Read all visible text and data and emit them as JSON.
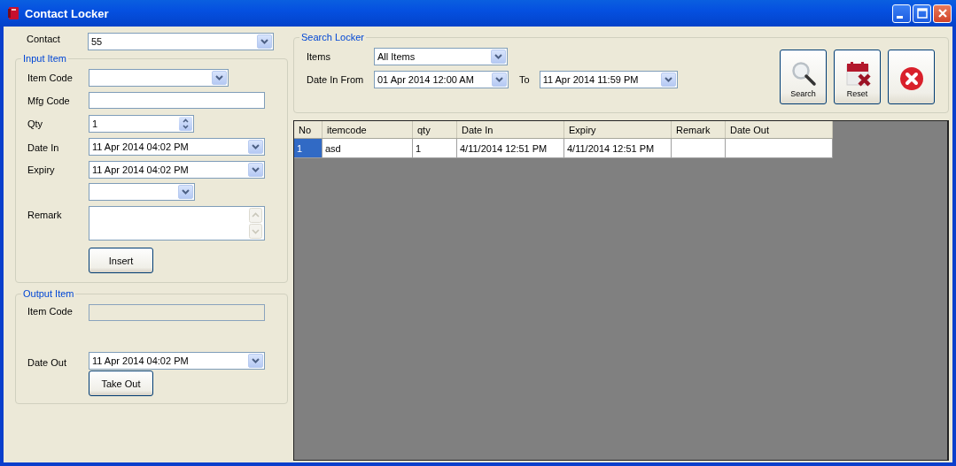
{
  "window": {
    "title": "Contact Locker"
  },
  "contact": {
    "label": "Contact",
    "value": "55"
  },
  "input_item": {
    "title": "Input Item",
    "fields": [
      {
        "kind": "combo",
        "label": "Item Code"
      },
      {
        "kind": "text",
        "label": "Mfg Code"
      },
      {
        "kind": "spinner",
        "label": "Qty",
        "value": "1"
      },
      {
        "kind": "date",
        "label": "Date In",
        "value": "11  Apr  2014 04:02 PM"
      },
      {
        "kind": "date",
        "label": "Expiry",
        "value": "11  Apr  2014  04:02 PM"
      },
      {
        "kind": "combo"
      },
      {
        "kind": "memo",
        "label": "Remark"
      }
    ],
    "button": "Insert"
  },
  "output_item": {
    "title": "Output Item",
    "fields": [
      {
        "kind": "text",
        "label": "Item Code",
        "disabled": true
      },
      {
        "kind": "date",
        "label": "Date Out",
        "value": "11  Apr  2014 04:02 PM"
      }
    ],
    "button": "Take Out"
  },
  "search_locker": {
    "title": "Search Locker",
    "items": {
      "label": "Items",
      "value": "All Items"
    },
    "date_from": {
      "label": "Date In From",
      "value": "01  Apr  2014 12:00 AM"
    },
    "date_to": {
      "label": "To",
      "value": "11  Apr  2014  11:59 PM"
    }
  },
  "toolbar": [
    {
      "kind": "search",
      "label": "Search"
    },
    {
      "kind": "reset",
      "label": "Reset"
    },
    {
      "kind": "close"
    }
  ],
  "table": {
    "columns": [
      "No",
      "itemcode",
      "qty",
      "Date In",
      "Expiry",
      "Remark",
      "Date Out"
    ],
    "rows": [
      {
        "selected": true,
        "cells": [
          "1",
          "asd",
          "1",
          "4/11/2014 12:51 PM",
          "4/11/2014 12:51 PM"
        ]
      }
    ]
  }
}
